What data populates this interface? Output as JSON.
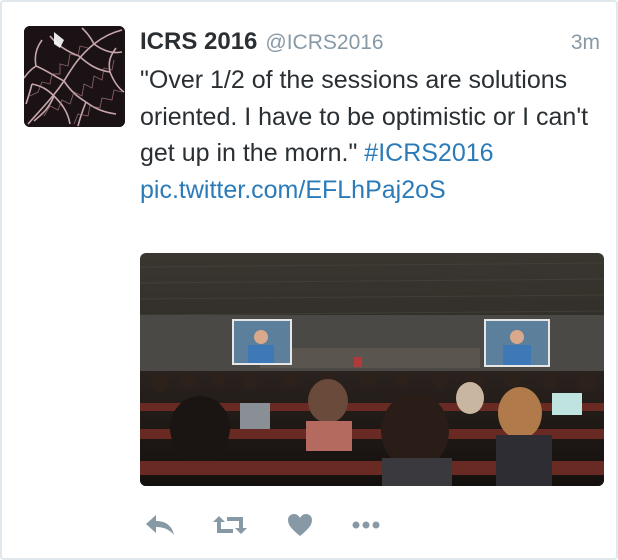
{
  "tweet": {
    "display_name": "ICRS 2016",
    "handle": "@ICRS2016",
    "timestamp": "3m",
    "text_main": "\"Over 1/2 of the sessions are solutions oriented. I have to be optimistic or I can't get up in the morn.\"",
    "hashtag": "#ICRS2016",
    "link": "pic.twitter.com/EFLhPaj2oS"
  },
  "actions": {
    "reply_icon": "reply-icon",
    "retweet_icon": "retweet-icon",
    "like_icon": "heart-icon",
    "more_icon": "more-icon"
  },
  "colors": {
    "link": "#2b7bb9",
    "text": "#292f33",
    "muted": "#8899a6",
    "icon": "#8899a6",
    "border": "#e1e8ed"
  }
}
